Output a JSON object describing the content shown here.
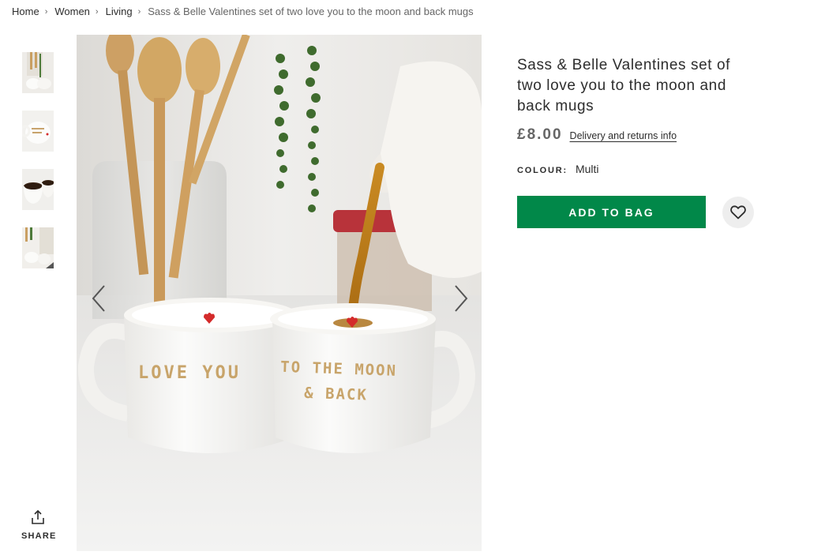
{
  "breadcrumb": {
    "items": [
      "Home",
      "Women",
      "Living"
    ],
    "current": "Sass & Belle Valentines set of two love you to the moon and back mugs",
    "separator": "›"
  },
  "gallery": {
    "thumbnail_count": 4,
    "share_label": "SHARE",
    "main_image": {
      "mug_left_text": "LOVE YOU",
      "mug_right_text_line1": "TO THE MOON",
      "mug_right_text_line2": "& BACK"
    }
  },
  "product": {
    "title": "Sass & Belle Valentines set of two love you to the moon and back mugs",
    "price": "£8.00",
    "delivery_link": "Delivery and returns info",
    "colour_label": "COLOUR:",
    "colour_value": "Multi",
    "add_to_bag": "ADD TO BAG"
  },
  "colors": {
    "add_to_bag_bg": "#018849",
    "save_bg": "#eeeeee",
    "heart_red": "#d42b2b",
    "text_primary": "#2d2d2d",
    "text_muted": "#666666"
  },
  "icons": {
    "share": "share-icon",
    "save": "heart-outline-icon",
    "prev": "chevron-left-icon",
    "next": "chevron-right-icon"
  }
}
